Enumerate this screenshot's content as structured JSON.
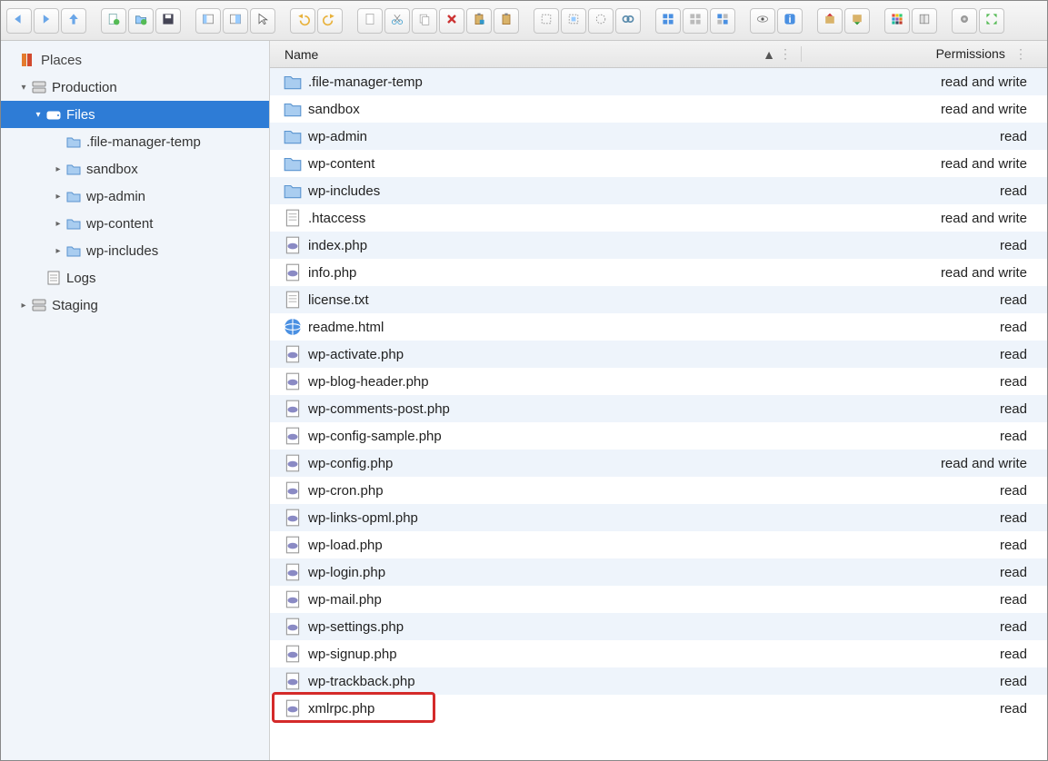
{
  "toolbar": {
    "groups": [
      [
        "back",
        "forward",
        "up"
      ],
      [
        "new-file",
        "new-folder",
        "save"
      ],
      [
        "panel-left",
        "panel-both",
        "cursor"
      ],
      [
        "undo",
        "redo"
      ],
      [
        "doc",
        "cut",
        "copy",
        "delete",
        "paste-special",
        "paste"
      ],
      [
        "dotted",
        "select-rect",
        "select-lasso",
        "link"
      ],
      [
        "grid-blue",
        "grid-grey",
        "grid-mix"
      ],
      [
        "eye",
        "info"
      ],
      [
        "export",
        "import"
      ],
      [
        "apps",
        "book"
      ],
      [
        "gear",
        "fullscreen"
      ]
    ]
  },
  "sidebar": {
    "places_label": "Places",
    "tree": [
      {
        "expand": "▾",
        "icon": "server",
        "label": "Production",
        "indent": 0
      },
      {
        "expand": "▾",
        "icon": "drive",
        "label": "Files",
        "indent": 1,
        "selected": true
      },
      {
        "expand": "",
        "icon": "folder",
        "label": ".file-manager-temp",
        "indent": 2
      },
      {
        "expand": "▸",
        "icon": "folder",
        "label": "sandbox",
        "indent": 2
      },
      {
        "expand": "▸",
        "icon": "folder",
        "label": "wp-admin",
        "indent": 2
      },
      {
        "expand": "▸",
        "icon": "folder",
        "label": "wp-content",
        "indent": 2
      },
      {
        "expand": "▸",
        "icon": "folder",
        "label": "wp-includes",
        "indent": 2
      },
      {
        "expand": "",
        "icon": "logs",
        "label": "Logs",
        "indent": 1
      },
      {
        "expand": "▸",
        "icon": "server",
        "label": "Staging",
        "indent": 0
      }
    ]
  },
  "list": {
    "col_name": "Name",
    "col_perm": "Permissions",
    "sort_indicator": "▲",
    "rows": [
      {
        "icon": "folder",
        "name": ".file-manager-temp",
        "perm": "read and write"
      },
      {
        "icon": "folder",
        "name": "sandbox",
        "perm": "read and write"
      },
      {
        "icon": "folder",
        "name": "wp-admin",
        "perm": "read"
      },
      {
        "icon": "folder",
        "name": "wp-content",
        "perm": "read and write"
      },
      {
        "icon": "folder",
        "name": "wp-includes",
        "perm": "read"
      },
      {
        "icon": "doc",
        "name": ".htaccess",
        "perm": "read and write"
      },
      {
        "icon": "php",
        "name": "index.php",
        "perm": "read"
      },
      {
        "icon": "php",
        "name": "info.php",
        "perm": "read and write"
      },
      {
        "icon": "doc",
        "name": "license.txt",
        "perm": "read"
      },
      {
        "icon": "globe",
        "name": "readme.html",
        "perm": "read"
      },
      {
        "icon": "php",
        "name": "wp-activate.php",
        "perm": "read"
      },
      {
        "icon": "php",
        "name": "wp-blog-header.php",
        "perm": "read"
      },
      {
        "icon": "php",
        "name": "wp-comments-post.php",
        "perm": "read"
      },
      {
        "icon": "php",
        "name": "wp-config-sample.php",
        "perm": "read"
      },
      {
        "icon": "php",
        "name": "wp-config.php",
        "perm": "read and write"
      },
      {
        "icon": "php",
        "name": "wp-cron.php",
        "perm": "read"
      },
      {
        "icon": "php",
        "name": "wp-links-opml.php",
        "perm": "read"
      },
      {
        "icon": "php",
        "name": "wp-load.php",
        "perm": "read"
      },
      {
        "icon": "php",
        "name": "wp-login.php",
        "perm": "read"
      },
      {
        "icon": "php",
        "name": "wp-mail.php",
        "perm": "read"
      },
      {
        "icon": "php",
        "name": "wp-settings.php",
        "perm": "read"
      },
      {
        "icon": "php",
        "name": "wp-signup.php",
        "perm": "read"
      },
      {
        "icon": "php",
        "name": "wp-trackback.php",
        "perm": "read"
      },
      {
        "icon": "php",
        "name": "xmlrpc.php",
        "perm": "read",
        "highlight": true
      }
    ]
  }
}
